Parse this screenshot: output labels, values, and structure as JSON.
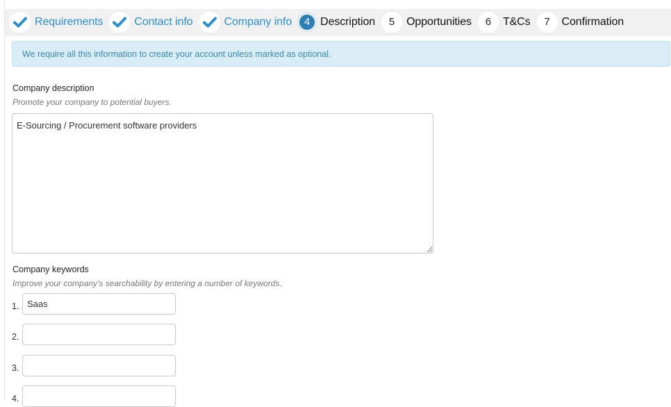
{
  "stepper": {
    "steps": [
      {
        "badge": "",
        "label": "Requirements",
        "state": "done"
      },
      {
        "badge": "",
        "label": "Contact info",
        "state": "done"
      },
      {
        "badge": "",
        "label": "Company info",
        "state": "done"
      },
      {
        "badge": "4",
        "label": "Description",
        "state": "active"
      },
      {
        "badge": "5",
        "label": "Opportunities",
        "state": "todo"
      },
      {
        "badge": "6",
        "label": "T&Cs",
        "state": "todo"
      },
      {
        "badge": "7",
        "label": "Confirmation",
        "state": "todo"
      }
    ],
    "done_icon": "check-icon",
    "colors": {
      "done_text": "#2b8fc9",
      "active_badge": "#2c7fb2"
    }
  },
  "alert": {
    "text": "We require all this information to create your account unless marked as optional."
  },
  "description": {
    "label": "Company description",
    "help": "Promote your company to potential buyers.",
    "value": "E-Sourcing / Procurement software providers"
  },
  "keywords": {
    "label": "Company keywords",
    "help": "Improve your company's searchability by entering a number of keywords.",
    "items": [
      {
        "num": "1.",
        "value": "Saas"
      },
      {
        "num": "2.",
        "value": ""
      },
      {
        "num": "3.",
        "value": ""
      },
      {
        "num": "4.",
        "value": ""
      }
    ]
  }
}
